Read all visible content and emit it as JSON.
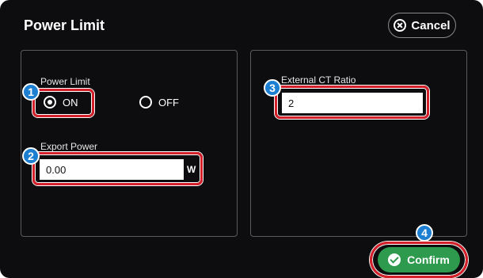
{
  "header": {
    "title": "Power Limit",
    "cancel_label": "Cancel",
    "cancel_icon": "close-circle-icon"
  },
  "power_limit": {
    "label": "Power Limit",
    "options": [
      "ON",
      "OFF"
    ],
    "selected": "ON"
  },
  "export_power": {
    "label": "Export Power",
    "value": "0.00",
    "unit": "W"
  },
  "external_ct": {
    "label": "External CT Ratio",
    "value": "2"
  },
  "footer": {
    "confirm_label": "Confirm",
    "confirm_icon": "check-circle-icon"
  },
  "callouts": [
    "1",
    "2",
    "3",
    "4"
  ],
  "colors": {
    "background": "#0d0d0f",
    "highlight": "#d4202a",
    "badge": "#1c7fd1",
    "confirm": "#2e9a4e"
  }
}
